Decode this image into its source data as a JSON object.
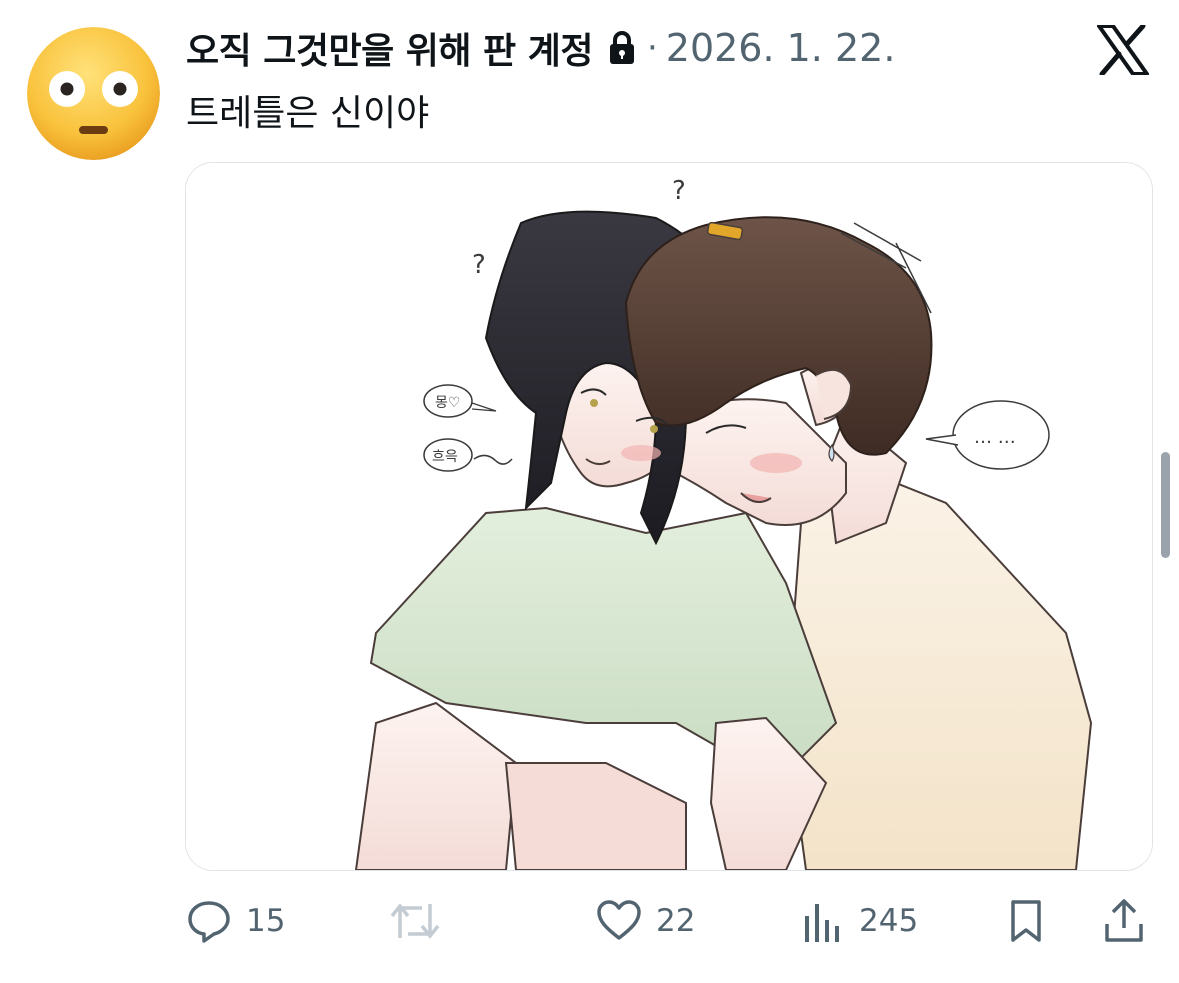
{
  "tweet": {
    "author": {
      "display_name": "오직 그것만을 위해 판 계정",
      "avatar_icon": "flushed-face-emoji-icon",
      "protected_icon": "lock-icon"
    },
    "separator": "·",
    "date": "2026. 1. 22.",
    "text": "트레틀은 신이야",
    "media": {
      "type": "illustration",
      "bubble_left_1": "몽♡",
      "bubble_left_2": "흐윽",
      "bubble_right": "… …",
      "question_mark": "?"
    },
    "actions": {
      "reply": {
        "icon": "reply-icon",
        "count": "15"
      },
      "retweet": {
        "icon": "retweet-icon",
        "count": ""
      },
      "like": {
        "icon": "heart-icon",
        "count": "22"
      },
      "views": {
        "icon": "views-chart-icon",
        "count": "245"
      },
      "bookmark": {
        "icon": "bookmark-icon"
      },
      "share": {
        "icon": "share-icon"
      }
    }
  },
  "brand": {
    "logo_icon": "x-logo-icon"
  },
  "colors": {
    "text_primary": "#0f1419",
    "text_secondary": "#536471",
    "retweet_disabled": "#c4ccd3",
    "border": "#dfe4e8"
  }
}
